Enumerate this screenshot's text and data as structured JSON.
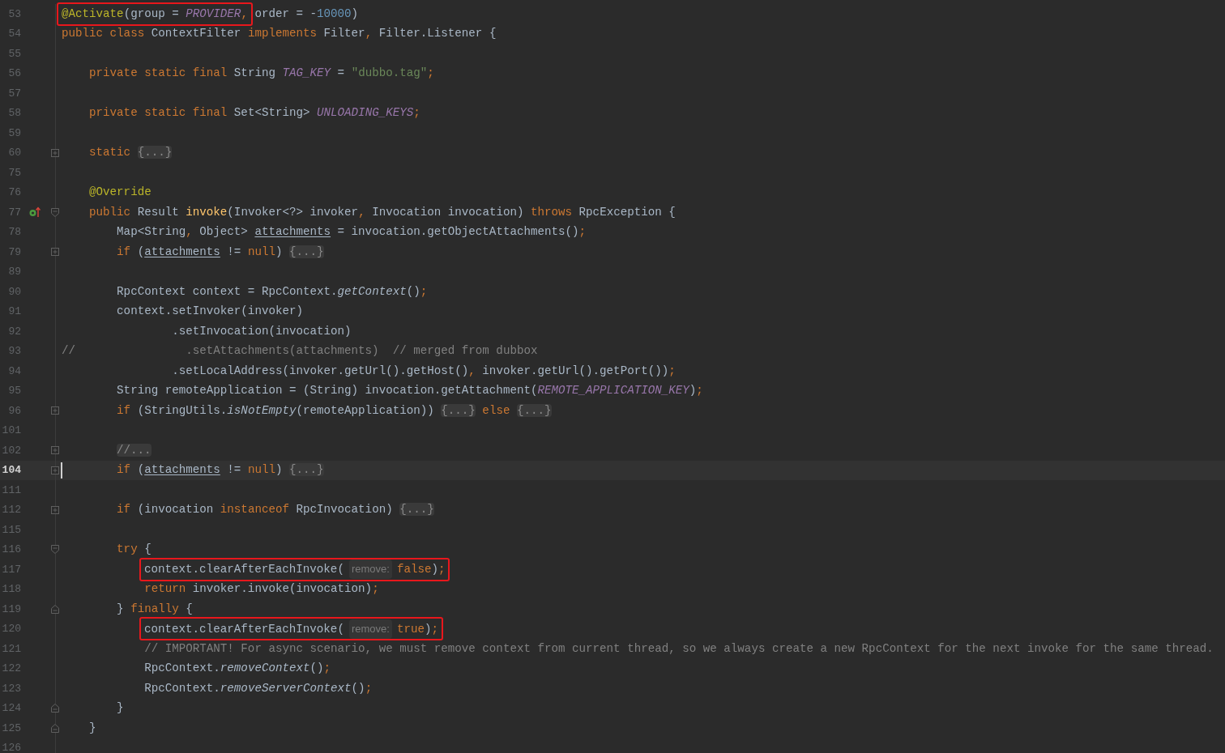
{
  "editor": {
    "lines": [
      {
        "number": "53",
        "current": false,
        "overridden": false,
        "fold_collapsed": false,
        "fold_start": false,
        "fold_end": false,
        "tokens": [
          {
            "kind": "box",
            "parts": [
              {
                "kind": "annotation",
                "text": "@Activate"
              },
              {
                "kind": "plain",
                "text": "(group = "
              },
              {
                "kind": "field",
                "text": "PROVIDER"
              },
              {
                "kind": "keyword",
                "text": ","
              }
            ]
          },
          {
            "kind": "plain",
            "text": " order = -"
          },
          {
            "kind": "number",
            "text": "10000"
          },
          {
            "kind": "plain",
            "text": ")"
          }
        ]
      },
      {
        "number": "54",
        "current": false,
        "overridden": false,
        "fold_collapsed": false,
        "fold_start": false,
        "fold_end": false,
        "tokens": [
          {
            "kind": "keyword",
            "text": "public class"
          },
          {
            "kind": "plain",
            "text": " ContextFilter "
          },
          {
            "kind": "keyword",
            "text": "implements"
          },
          {
            "kind": "plain",
            "text": " Filter"
          },
          {
            "kind": "keyword",
            "text": ","
          },
          {
            "kind": "plain",
            "text": " Filter.Listener {"
          }
        ]
      },
      {
        "number": "55",
        "current": false,
        "overridden": false,
        "fold_collapsed": false,
        "fold_start": false,
        "fold_end": false
      },
      {
        "number": "56",
        "current": false,
        "overridden": false,
        "fold_collapsed": false,
        "fold_start": false,
        "fold_end": false,
        "tokens": [
          {
            "kind": "keyword",
            "text": "    private static final"
          },
          {
            "kind": "plain",
            "text": " String "
          },
          {
            "kind": "field",
            "text": "TAG_KEY"
          },
          {
            "kind": "plain",
            "text": " = "
          },
          {
            "kind": "string",
            "text": "\"dubbo.tag\""
          },
          {
            "kind": "keyword",
            "text": ";"
          }
        ]
      },
      {
        "number": "57",
        "current": false,
        "overridden": false,
        "fold_collapsed": false,
        "fold_start": false,
        "fold_end": false
      },
      {
        "number": "58",
        "current": false,
        "overridden": false,
        "fold_collapsed": false,
        "fold_start": false,
        "fold_end": false,
        "tokens": [
          {
            "kind": "keyword",
            "text": "    private static final"
          },
          {
            "kind": "plain",
            "text": " Set<String> "
          },
          {
            "kind": "field",
            "text": "UNLOADING_KEYS"
          },
          {
            "kind": "keyword",
            "text": ";"
          }
        ]
      },
      {
        "number": "59",
        "current": false,
        "overridden": false,
        "fold_collapsed": false,
        "fold_start": false,
        "fold_end": false
      },
      {
        "number": "60",
        "current": false,
        "overridden": false,
        "fold_collapsed": true,
        "fold_start": false,
        "fold_end": false,
        "tokens": [
          {
            "kind": "keyword",
            "text": "    static "
          },
          {
            "kind": "folded",
            "text": "{...}"
          }
        ]
      },
      {
        "number": "75",
        "current": false,
        "overridden": false,
        "fold_collapsed": false,
        "fold_start": false,
        "fold_end": false
      },
      {
        "number": "76",
        "current": false,
        "overridden": false,
        "fold_collapsed": false,
        "fold_start": false,
        "fold_end": false,
        "tokens": [
          {
            "kind": "annotation",
            "text": "    @Override"
          }
        ]
      },
      {
        "number": "77",
        "current": false,
        "overridden": true,
        "fold_collapsed": false,
        "fold_start": true,
        "fold_end": false,
        "tokens": [
          {
            "kind": "keyword",
            "text": "    public"
          },
          {
            "kind": "plain",
            "text": " Result "
          },
          {
            "kind": "method",
            "text": "invoke"
          },
          {
            "kind": "plain",
            "text": "(Invoker<?> invoker"
          },
          {
            "kind": "keyword",
            "text": ","
          },
          {
            "kind": "plain",
            "text": " Invocation invocation) "
          },
          {
            "kind": "keyword",
            "text": "throws"
          },
          {
            "kind": "plain",
            "text": " RpcException {"
          }
        ]
      },
      {
        "number": "78",
        "current": false,
        "overridden": false,
        "fold_collapsed": false,
        "fold_start": false,
        "fold_end": false,
        "tokens": [
          {
            "kind": "plain",
            "text": "        Map<String"
          },
          {
            "kind": "keyword",
            "text": ","
          },
          {
            "kind": "plain",
            "text": " Object> "
          },
          {
            "kind": "reassigned",
            "text": "attachments"
          },
          {
            "kind": "plain",
            "text": " = invocation.getObjectAttachments()"
          },
          {
            "kind": "keyword",
            "text": ";"
          }
        ]
      },
      {
        "number": "79",
        "current": false,
        "overridden": false,
        "fold_collapsed": true,
        "fold_start": false,
        "fold_end": false,
        "tokens": [
          {
            "kind": "keyword",
            "text": "        if"
          },
          {
            "kind": "plain",
            "text": " ("
          },
          {
            "kind": "reassigned",
            "text": "attachments"
          },
          {
            "kind": "plain",
            "text": " != "
          },
          {
            "kind": "keyword",
            "text": "null"
          },
          {
            "kind": "plain",
            "text": ") "
          },
          {
            "kind": "folded",
            "text": "{...}"
          }
        ]
      },
      {
        "number": "89",
        "current": false,
        "overridden": false,
        "fold_collapsed": false,
        "fold_start": false,
        "fold_end": false
      },
      {
        "number": "90",
        "current": false,
        "overridden": false,
        "fold_collapsed": false,
        "fold_start": false,
        "fold_end": false,
        "tokens": [
          {
            "kind": "plain",
            "text": "        RpcContext context = RpcContext."
          },
          {
            "kind": "static",
            "text": "getContext"
          },
          {
            "kind": "plain",
            "text": "()"
          },
          {
            "kind": "keyword",
            "text": ";"
          }
        ]
      },
      {
        "number": "91",
        "current": false,
        "overridden": false,
        "fold_collapsed": false,
        "fold_start": false,
        "fold_end": false,
        "tokens": [
          {
            "kind": "plain",
            "text": "        context.setInvoker(invoker)"
          }
        ]
      },
      {
        "number": "92",
        "current": false,
        "overridden": false,
        "fold_collapsed": false,
        "fold_start": false,
        "fold_end": false,
        "tokens": [
          {
            "kind": "plain",
            "text": "                .setInvocation(invocation)"
          }
        ]
      },
      {
        "number": "93",
        "current": false,
        "overridden": false,
        "fold_collapsed": false,
        "fold_start": false,
        "fold_end": false,
        "tokens": [
          {
            "kind": "comment",
            "text": "//                .setAttachments(attachments)  // merged from dubbox"
          }
        ]
      },
      {
        "number": "94",
        "current": false,
        "overridden": false,
        "fold_collapsed": false,
        "fold_start": false,
        "fold_end": false,
        "tokens": [
          {
            "kind": "plain",
            "text": "                .setLocalAddress(invoker.getUrl().getHost()"
          },
          {
            "kind": "keyword",
            "text": ","
          },
          {
            "kind": "plain",
            "text": " invoker.getUrl().getPort())"
          },
          {
            "kind": "keyword",
            "text": ";"
          }
        ]
      },
      {
        "number": "95",
        "current": false,
        "overridden": false,
        "fold_collapsed": false,
        "fold_start": false,
        "fold_end": false,
        "tokens": [
          {
            "kind": "plain",
            "text": "        String remoteApplication = (String) invocation.getAttachment("
          },
          {
            "kind": "field",
            "text": "REMOTE_APPLICATION_KEY"
          },
          {
            "kind": "plain",
            "text": ")"
          },
          {
            "kind": "keyword",
            "text": ";"
          }
        ]
      },
      {
        "number": "96",
        "current": false,
        "overridden": false,
        "fold_collapsed": true,
        "fold_start": false,
        "fold_end": false,
        "tokens": [
          {
            "kind": "keyword",
            "text": "        if"
          },
          {
            "kind": "plain",
            "text": " (StringUtils."
          },
          {
            "kind": "static",
            "text": "isNotEmpty"
          },
          {
            "kind": "plain",
            "text": "(remoteApplication)) "
          },
          {
            "kind": "folded",
            "text": "{...}"
          },
          {
            "kind": "keyword",
            "text": " else "
          },
          {
            "kind": "folded",
            "text": "{...}"
          }
        ]
      },
      {
        "number": "101",
        "current": false,
        "overridden": false,
        "fold_collapsed": false,
        "fold_start": false,
        "fold_end": false
      },
      {
        "number": "102",
        "current": false,
        "overridden": false,
        "fold_collapsed": true,
        "fold_start": false,
        "fold_end": false,
        "tokens": [
          {
            "kind": "folded",
            "text": "//...",
            "indented": true
          }
        ]
      },
      {
        "number": "104",
        "current": true,
        "overridden": false,
        "fold_collapsed": true,
        "fold_start": false,
        "fold_end": false,
        "tokens": [
          {
            "kind": "keyword",
            "text": "        if"
          },
          {
            "kind": "plain",
            "text": " ("
          },
          {
            "kind": "reassigned",
            "text": "attachments"
          },
          {
            "kind": "plain",
            "text": " != "
          },
          {
            "kind": "keyword",
            "text": "null"
          },
          {
            "kind": "plain",
            "text": ") "
          },
          {
            "kind": "folded",
            "text": "{...}"
          }
        ]
      },
      {
        "number": "111",
        "current": false,
        "overridden": false,
        "fold_collapsed": false,
        "fold_start": false,
        "fold_end": false
      },
      {
        "number": "112",
        "current": false,
        "overridden": false,
        "fold_collapsed": true,
        "fold_start": false,
        "fold_end": false,
        "tokens": [
          {
            "kind": "keyword",
            "text": "        if"
          },
          {
            "kind": "plain",
            "text": " (invocation "
          },
          {
            "kind": "keyword",
            "text": "instanceof"
          },
          {
            "kind": "plain",
            "text": " RpcInvocation) "
          },
          {
            "kind": "folded",
            "text": "{...}"
          }
        ]
      },
      {
        "number": "115",
        "current": false,
        "overridden": false,
        "fold_collapsed": false,
        "fold_start": false,
        "fold_end": false
      },
      {
        "number": "116",
        "current": false,
        "overridden": false,
        "fold_collapsed": false,
        "fold_start": true,
        "fold_end": false,
        "tokens": [
          {
            "kind": "keyword",
            "text": "        try"
          },
          {
            "kind": "plain",
            "text": " {"
          }
        ]
      },
      {
        "number": "117",
        "current": false,
        "overridden": false,
        "fold_collapsed": false,
        "fold_start": false,
        "fold_end": false,
        "tokens": [
          {
            "kind": "box",
            "indented": true,
            "parts": [
              {
                "kind": "plain",
                "text": "context.clearAfterEachInvoke("
              },
              {
                "kind": "hint",
                "text": "remove:"
              },
              {
                "kind": "keyword",
                "text": "false"
              },
              {
                "kind": "plain",
                "text": ")"
              },
              {
                "kind": "keyword",
                "text": ";"
              }
            ]
          }
        ]
      },
      {
        "number": "118",
        "current": false,
        "overridden": false,
        "fold_collapsed": false,
        "fold_start": false,
        "fold_end": false,
        "tokens": [
          {
            "kind": "keyword",
            "text": "            return"
          },
          {
            "kind": "plain",
            "text": " invoker.invoke(invocation)"
          },
          {
            "kind": "keyword",
            "text": ";"
          }
        ]
      },
      {
        "number": "119",
        "current": false,
        "overridden": false,
        "fold_collapsed": false,
        "fold_start": false,
        "fold_end": true,
        "tokens": [
          {
            "kind": "plain",
            "text": "        } "
          },
          {
            "kind": "keyword",
            "text": "finally"
          },
          {
            "kind": "plain",
            "text": " {"
          }
        ]
      },
      {
        "number": "120",
        "current": false,
        "overridden": false,
        "fold_collapsed": false,
        "fold_start": false,
        "fold_end": false,
        "tokens": [
          {
            "kind": "box",
            "indented": true,
            "parts": [
              {
                "kind": "plain",
                "text": "context.clearAfterEachInvoke("
              },
              {
                "kind": "hint",
                "text": "remove:"
              },
              {
                "kind": "keyword",
                "text": "true"
              },
              {
                "kind": "plain",
                "text": ")"
              },
              {
                "kind": "keyword",
                "text": ";"
              }
            ]
          }
        ]
      },
      {
        "number": "121",
        "current": false,
        "overridden": false,
        "fold_collapsed": false,
        "fold_start": false,
        "fold_end": false,
        "tokens": [
          {
            "kind": "comment",
            "text": "            // IMPORTANT! For async scenario, we must remove context from current thread, so we always create a new RpcContext for the next invoke for the same thread."
          }
        ]
      },
      {
        "number": "122",
        "current": false,
        "overridden": false,
        "fold_collapsed": false,
        "fold_start": false,
        "fold_end": false,
        "tokens": [
          {
            "kind": "plain",
            "text": "            RpcContext."
          },
          {
            "kind": "static",
            "text": "removeContext"
          },
          {
            "kind": "plain",
            "text": "()"
          },
          {
            "kind": "keyword",
            "text": ";"
          }
        ]
      },
      {
        "number": "123",
        "current": false,
        "overridden": false,
        "fold_collapsed": false,
        "fold_start": false,
        "fold_end": false,
        "tokens": [
          {
            "kind": "plain",
            "text": "            RpcContext."
          },
          {
            "kind": "static",
            "text": "removeServerContext"
          },
          {
            "kind": "plain",
            "text": "()"
          },
          {
            "kind": "keyword",
            "text": ";"
          }
        ]
      },
      {
        "number": "124",
        "current": false,
        "overridden": false,
        "fold_collapsed": false,
        "fold_start": false,
        "fold_end": true,
        "tokens": [
          {
            "kind": "plain",
            "text": "        }"
          }
        ]
      },
      {
        "number": "125",
        "current": false,
        "overridden": false,
        "fold_collapsed": false,
        "fold_start": false,
        "fold_end": true,
        "tokens": [
          {
            "kind": "plain",
            "text": "    }"
          }
        ]
      },
      {
        "number": "126",
        "current": false,
        "overridden": false,
        "fold_collapsed": false,
        "fold_start": false,
        "fold_end": false
      }
    ]
  }
}
